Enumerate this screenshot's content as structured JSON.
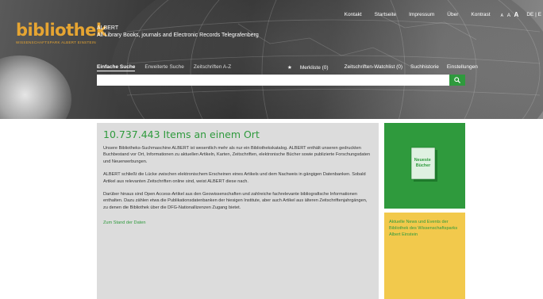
{
  "logo": {
    "word": "bibliothek",
    "sub": "WISSENSCHAFTSPARK ALBERT EINSTEIN"
  },
  "site": {
    "name": "ALBERT",
    "tagline": "All Library Books, journals and Electronic Records Telegrafenberg"
  },
  "topnav": {
    "items": [
      "Kontakt",
      "Startseite",
      "Impressum",
      "Über",
      "Kontrast"
    ],
    "sizes": [
      "A",
      "A",
      "A"
    ],
    "lang": "DE | E"
  },
  "search": {
    "tabs": [
      "Einfache Suche",
      "Erweiterte Suche",
      "Zeitschriften A-Z"
    ],
    "user_links": [
      "Merkliste (0)",
      "Zeitschriften-Watchlist (0)",
      "Suchhistorie",
      "Einstellungen"
    ],
    "placeholder": "",
    "value": ""
  },
  "main": {
    "heading": "10.737.443 Items an einem Ort",
    "paragraphs": [
      "Unsere Bibliotheks-Suchmaschine ALBERT ist wesentlich mehr als nur ein Bibliothekskatalog. ALBERT enthält unseren gedruckten Buchbestand vor Ort, Informationen zu aktuellen Artikeln, Karten, Zeitschriften, elektronische Bücher sowie publizierte Forschungsdaten und Neuerwerbungen.",
      "ALBERT schließt die Lücke zwischen elektronischem Erscheinen eines Artikels und dem Nachweis in gängigen Datenbanken. Sobald Artikel aus relevanten Zeitschriften online sind, weist ALBERT diese nach.",
      "Darüber hinaus sind Open Access-Artikel aus den Geowissenschaften und zahlreiche fachrelevante bibliografische Informationen enthalten. Dazu zählen etwa die Publikationsdatenbanken der hiesigen Institute, aber auch Artikel aus älteren Zeitschriftenjahrgängen, zu denen die Bibliothek über die DFG-Nationallizenzen Zugang bietet."
    ],
    "link": "Zum Stand der Daten"
  },
  "tiles": {
    "new_books": "Neueste Bücher",
    "news": "Aktuelle News und Events der Bibliothek des Wissenschaftsparks Albert Einstein"
  },
  "colors": {
    "accent": "#2f9a3d",
    "logo": "#e6a532",
    "news_bg": "#f2c94c",
    "panel_bg": "#dcdcdc"
  }
}
